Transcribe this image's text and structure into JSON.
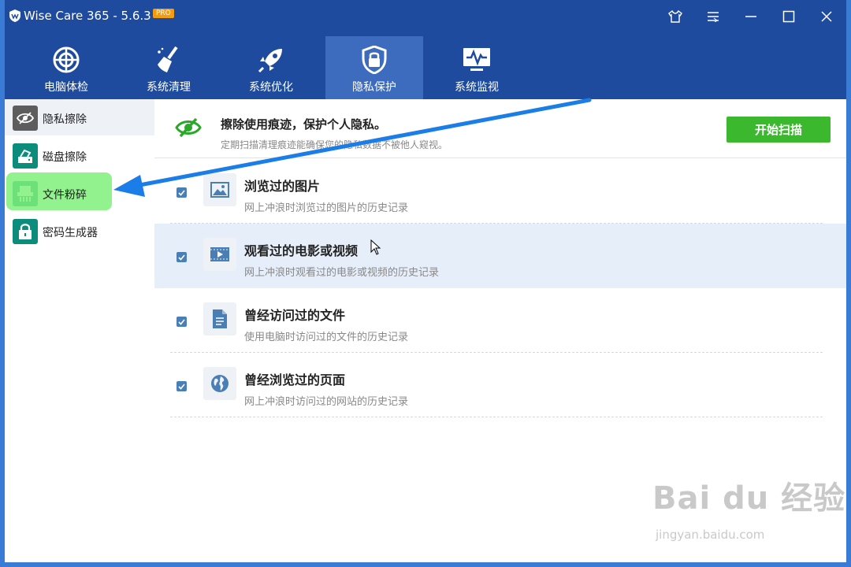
{
  "window": {
    "title": "Wise Care 365 - 5.6.3",
    "badge": "PRO"
  },
  "nav": [
    {
      "label": "电脑体检",
      "icon": "radar-icon"
    },
    {
      "label": "系统清理",
      "icon": "broom-icon"
    },
    {
      "label": "系统优化",
      "icon": "rocket-icon"
    },
    {
      "label": "隐私保护",
      "icon": "privacy-lock-icon",
      "active": true
    },
    {
      "label": "系统监视",
      "icon": "monitor-icon"
    }
  ],
  "sidebar": [
    {
      "label": "隐私擦除",
      "icon": "eye-slash-icon",
      "selected": true
    },
    {
      "label": "磁盘擦除",
      "icon": "disk-eraser-icon"
    },
    {
      "label": "文件粉碎",
      "icon": "shredder-icon"
    },
    {
      "label": "密码生成器",
      "icon": "lock-icon"
    }
  ],
  "banner": {
    "title": "擦除使用痕迹，保护个人隐私。",
    "subtitle": "定期扫描清理痕迹能确保您的隐私数据不被他人窥视。",
    "scan_button": "开始扫描"
  },
  "items": [
    {
      "title": "浏览过的图片",
      "desc": "网上冲浪时浏览过的图片的历史记录",
      "checked": true,
      "icon": "image-icon"
    },
    {
      "title": "观看过的电影或视频",
      "desc": "网上冲浪时观看过的电影或视频的历史记录",
      "checked": true,
      "icon": "video-icon"
    },
    {
      "title": "曾经访问过的文件",
      "desc": "使用电脑时访问过的文件的历史记录",
      "checked": true,
      "icon": "document-icon"
    },
    {
      "title": "曾经浏览过的页面",
      "desc": "网上冲浪时访问过的网站的历史记录",
      "checked": true,
      "icon": "globe-icon"
    }
  ],
  "watermark": {
    "main": "Bai du 经验",
    "url": "jingyan.baidu.com"
  },
  "colors": {
    "titlebar": "#1e4b9e",
    "nav_active": "#3d6bbd",
    "scan_button": "#3cb82e",
    "checkbox": "#4a7fb6",
    "arrow": "#1a7de8",
    "highlight": "#7ef07a"
  }
}
